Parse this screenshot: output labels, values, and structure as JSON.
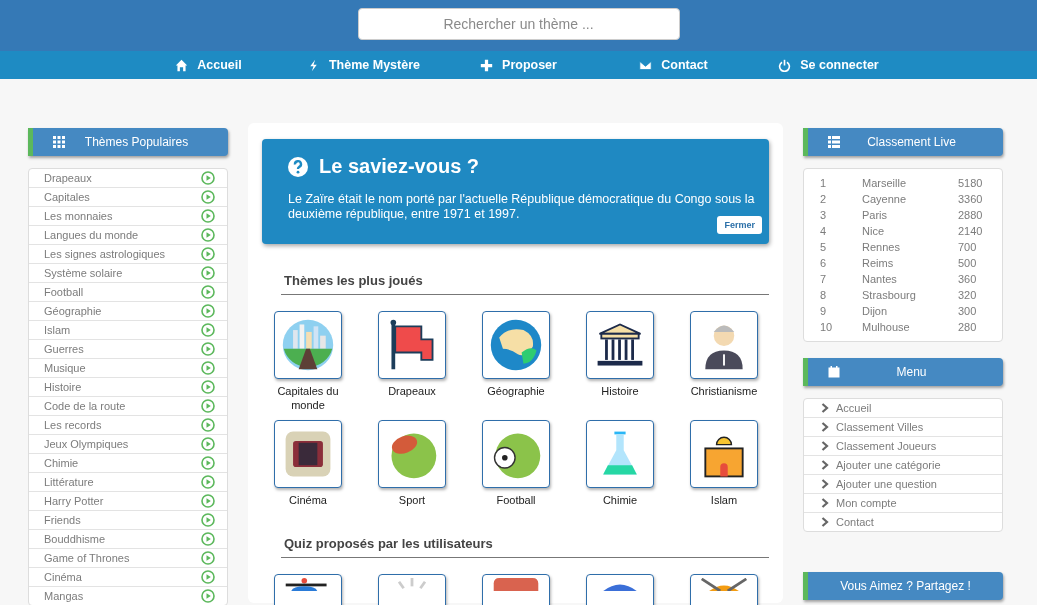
{
  "search": {
    "placeholder": "Rechercher un thème ..."
  },
  "nav": [
    {
      "kind": "home",
      "label": "Accueil"
    },
    {
      "kind": "bolt",
      "label": "Thème Mystère"
    },
    {
      "kind": "plus",
      "label": "Proposer"
    },
    {
      "kind": "envelope",
      "label": "Contact"
    },
    {
      "kind": "power",
      "label": "Se connecter"
    }
  ],
  "popular": {
    "title": "Thèmes Populaires",
    "items": [
      "Drapeaux",
      "Capitales",
      "Les monnaies",
      "Langues du monde",
      "Les signes astrologiques",
      "Système solaire",
      "Football",
      "Géographie",
      "Islam",
      "Guerres",
      "Musique",
      "Histoire",
      "Code de la route",
      "Les records",
      "Jeux Olympiques",
      "Chimie",
      "Littérature",
      "Harry Potter",
      "Friends",
      "Bouddhisme",
      "Game of Thrones",
      "Cinéma",
      "Mangas"
    ]
  },
  "fact": {
    "title": "Le saviez-vous ?",
    "text": "Le Zaïre était le nom porté par l'actuelle République démocratique du Congo sous la deuxième république, entre 1971 et 1997.",
    "close": "Fermer"
  },
  "most_played": {
    "title": "Thèmes les plus joués",
    "tiles": [
      {
        "kind": "city",
        "label": "Capitales du monde"
      },
      {
        "kind": "flag",
        "label": "Drapeaux"
      },
      {
        "kind": "globe",
        "label": "Géographie"
      },
      {
        "kind": "temple",
        "label": "Histoire"
      },
      {
        "kind": "priest",
        "label": "Christianisme"
      },
      {
        "kind": "film",
        "label": "Cinéma"
      },
      {
        "kind": "rugby",
        "label": "Sport"
      },
      {
        "kind": "soccer",
        "label": "Football"
      },
      {
        "kind": "flask",
        "label": "Chimie"
      },
      {
        "kind": "mosque",
        "label": "Islam"
      }
    ]
  },
  "user_quizzes": {
    "title": "Quiz proposés par les utilisateurs",
    "tiles": [
      {
        "kind": "helicopter"
      },
      {
        "kind": "burst"
      },
      {
        "kind": "box"
      },
      {
        "kind": "planet"
      },
      {
        "kind": "bones"
      }
    ]
  },
  "ranking": {
    "title": "Classement Live",
    "rows": [
      {
        "rank": "1",
        "city": "Marseille",
        "score": "5180"
      },
      {
        "rank": "2",
        "city": "Cayenne",
        "score": "3360"
      },
      {
        "rank": "3",
        "city": "Paris",
        "score": "2880"
      },
      {
        "rank": "4",
        "city": "Nice",
        "score": "2140"
      },
      {
        "rank": "5",
        "city": "Rennes",
        "score": "700"
      },
      {
        "rank": "6",
        "city": "Reims",
        "score": "500"
      },
      {
        "rank": "7",
        "city": "Nantes",
        "score": "360"
      },
      {
        "rank": "8",
        "city": "Strasbourg",
        "score": "320"
      },
      {
        "rank": "9",
        "city": "Dijon",
        "score": "300"
      },
      {
        "rank": "10",
        "city": "Mulhouse",
        "score": "280"
      }
    ]
  },
  "menu": {
    "title": "Menu",
    "items": [
      "Accueil",
      "Classement Villes",
      "Classement Joueurs",
      "Ajouter une catégorie",
      "Ajouter une question",
      "Mon compte",
      "Contact"
    ]
  },
  "share": {
    "title": "Vous Aimez ? Partagez !"
  }
}
